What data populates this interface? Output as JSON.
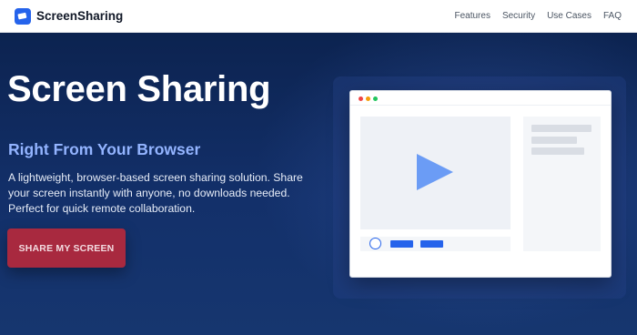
{
  "nav": {
    "brand": "ScreenSharing",
    "links": [
      {
        "label": "Features"
      },
      {
        "label": "Security"
      },
      {
        "label": "Use Cases"
      },
      {
        "label": "FAQ"
      }
    ]
  },
  "hero": {
    "title": "Screen Sharing",
    "subtitle": "Right From Your Browser",
    "description": "A lightweight, browser-based screen sharing solution. Share your screen instantly with anyone, no downloads needed. Perfect for quick remote collaboration.",
    "cta_label": "SHARE MY SCREEN"
  },
  "colors": {
    "brand_blue": "#2563eb",
    "cta_red": "#a8293f",
    "subtitle_blue": "#93b4ff",
    "hero_background": "#13306a"
  },
  "icons": {
    "brand": "screen-share-logo-icon",
    "play": "play-icon"
  }
}
